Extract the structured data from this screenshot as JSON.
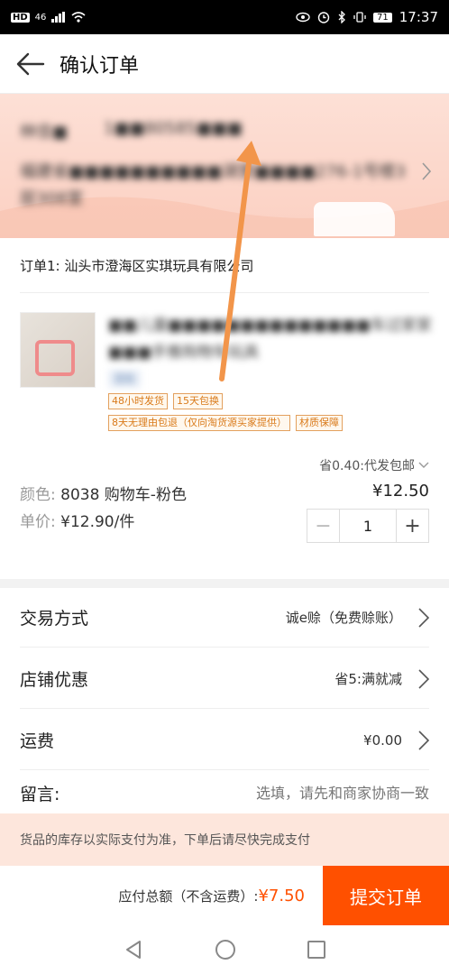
{
  "status_bar": {
    "hd": "HD",
    "signal": "46",
    "battery": "71",
    "time": "17:37"
  },
  "header": {
    "title": "确认订单"
  },
  "address": {
    "name": "林佳■",
    "phone": "1■■80585■■■",
    "line": "福建省■■■■■■■■■■湖里■■■■276-1号楼3层308室"
  },
  "shop": {
    "name": "订单1: 汕头市澄海区实琪玩具有限公司",
    "product_title": "■■儿童■■■■■■■■■■■■■■车过家家■■■手推购物车玩具",
    "mix_tag": "混批",
    "services": [
      "48小时发货",
      "15天包换"
    ],
    "services2": [
      "8天无理由包退（仅向淘货源买家提供）",
      "材质保障"
    ],
    "promo": "省0.40:代发包邮",
    "spec_label": "颜色:",
    "spec_value": "8038 购物车-粉色",
    "unit_label": "单价:",
    "unit_value": "¥12.90/件",
    "price": "¥12.50",
    "qty": "1",
    "minus": "−",
    "plus": "+"
  },
  "options": {
    "trade_label": "交易方式",
    "trade_value": "诚e赊（免费赊账）",
    "coupon_label": "店铺优惠",
    "coupon_value": "省5:满就减",
    "shipping_label": "运费",
    "shipping_value": "¥0.00",
    "msg_label": "留言:",
    "msg_placeholder": "选填，请先和商家协商一致"
  },
  "notice": {
    "text": "货品的库存以实际支付为准，下单后请尽快完成支付"
  },
  "footer": {
    "total_label": "应付总额（不含运费）:",
    "total_value": "¥7.50",
    "submit_label": "提交订单"
  },
  "colors": {
    "accent": "#ff5000",
    "annotation_arrow": "#f2954a"
  }
}
